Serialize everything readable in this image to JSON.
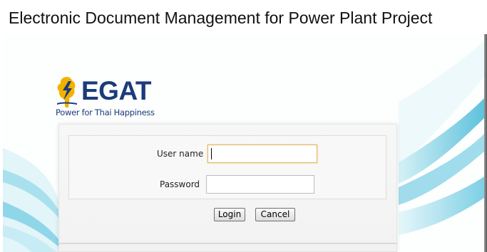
{
  "window": {
    "title": "Electronic Document Management for Power Plant Project"
  },
  "brand": {
    "logo_text": "EGAT",
    "tagline": "Power for Thai Happiness",
    "color": "#1b3b7a",
    "mark_icon": "thai-map-lightning-icon"
  },
  "login": {
    "username_label": "User name",
    "username_value": "",
    "password_label": "Password",
    "password_value": "",
    "login_button": "Login",
    "cancel_button": "Cancel",
    "focus_color": "#e1b561"
  },
  "background": {
    "swoosh_color": "#7fd3e6"
  }
}
